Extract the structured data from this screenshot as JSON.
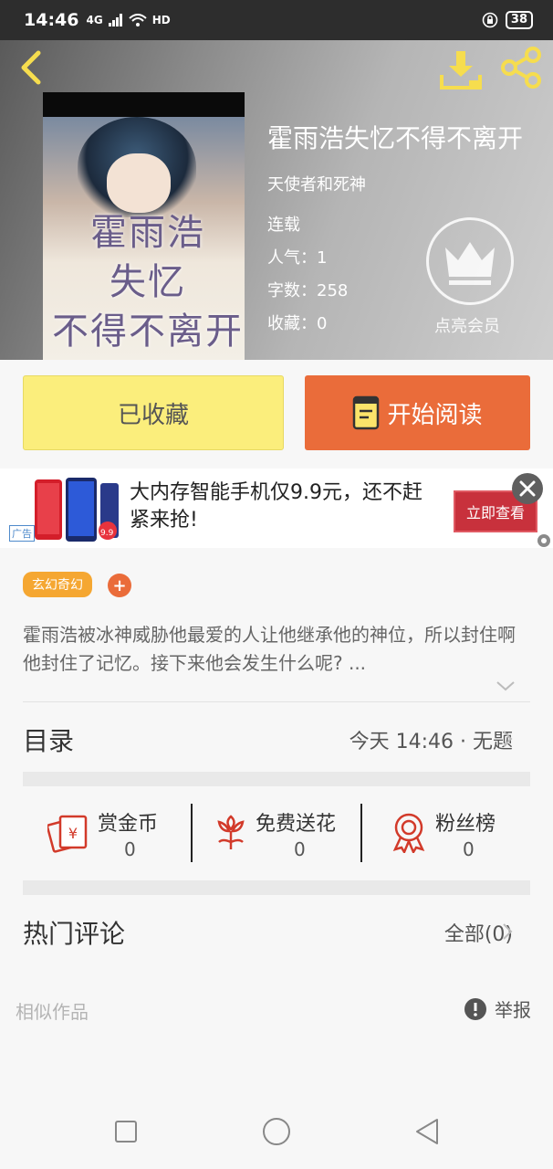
{
  "status_bar": {
    "time": "14:46",
    "network": "4G",
    "hd": "HD",
    "battery": "38"
  },
  "book": {
    "title": "霍雨浩失忆不得不离开",
    "author": "天使者和死神",
    "status": "连载",
    "popularity": "人气：1",
    "word_count": "字数：258",
    "favorites": "收藏：0",
    "cover_text": [
      "霍雨浩",
      "失忆",
      "不得不离开"
    ]
  },
  "vip": {
    "label": "点亮会员"
  },
  "actions": {
    "collected_label": "已收藏",
    "read_label": "开始阅读"
  },
  "ad": {
    "text": "大内存智能手机仅9.9元，还不赶紧来抢!",
    "cta": "立即查看",
    "tag": "广告",
    "price_badge": "9.9"
  },
  "tags": {
    "genre": "玄幻奇幻",
    "add": "+"
  },
  "description": "霍雨浩被冰神威胁他最爱的人让他继承他的神位，所以封住啊他封住了记忆。接下来他会发生什么呢? ...",
  "catalog": {
    "title": "目录",
    "latest": "今天 14:46 · 无题"
  },
  "stats": [
    {
      "label": "赏金币",
      "value": "0",
      "icon": "reward-coin-icon"
    },
    {
      "label": "免费送花",
      "value": "0",
      "icon": "flower-icon"
    },
    {
      "label": "粉丝榜",
      "value": "0",
      "icon": "badge-ribbon-icon"
    }
  ],
  "comments": {
    "title": "热门评论",
    "all_label": "全部(0)"
  },
  "footer": {
    "similar": "相似作品",
    "report": "举报"
  },
  "colors": {
    "accent_orange": "#ea6c3a",
    "collected_yellow": "#fbee7c",
    "tag_orange": "#f5a732",
    "icon_red": "#d23a2a"
  }
}
